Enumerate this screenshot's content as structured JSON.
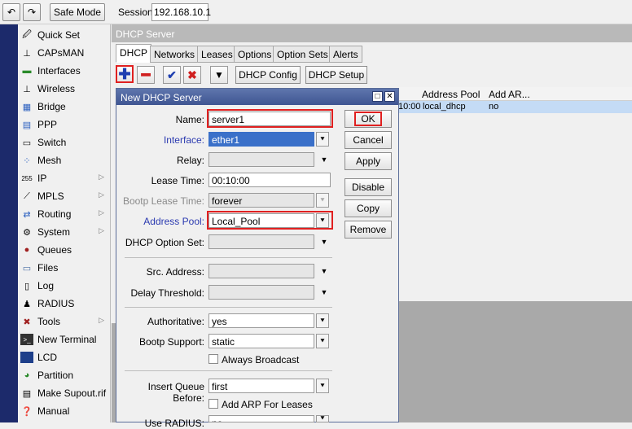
{
  "toolbar": {
    "undo_icon": "undo-icon",
    "redo_icon": "redo-icon",
    "safe_mode": "Safe Mode",
    "session_label": "Session:",
    "session_value": "192.168.10.1"
  },
  "sidebar": {
    "items": [
      {
        "label": "Quick Set",
        "icon": "quick-set-icon"
      },
      {
        "label": "CAPsMAN",
        "icon": "capsman-icon"
      },
      {
        "label": "Interfaces",
        "icon": "interfaces-icon"
      },
      {
        "label": "Wireless",
        "icon": "wireless-icon"
      },
      {
        "label": "Bridge",
        "icon": "bridge-icon"
      },
      {
        "label": "PPP",
        "icon": "ppp-icon"
      },
      {
        "label": "Switch",
        "icon": "switch-icon"
      },
      {
        "label": "Mesh",
        "icon": "mesh-icon"
      },
      {
        "label": "IP",
        "icon": "ip-icon",
        "submenu": true
      },
      {
        "label": "MPLS",
        "icon": "mpls-icon",
        "submenu": true
      },
      {
        "label": "Routing",
        "icon": "routing-icon",
        "submenu": true
      },
      {
        "label": "System",
        "icon": "system-icon",
        "submenu": true
      },
      {
        "label": "Queues",
        "icon": "queues-icon"
      },
      {
        "label": "Files",
        "icon": "files-icon"
      },
      {
        "label": "Log",
        "icon": "log-icon"
      },
      {
        "label": "RADIUS",
        "icon": "radius-icon"
      },
      {
        "label": "Tools",
        "icon": "tools-icon",
        "submenu": true
      },
      {
        "label": "New Terminal",
        "icon": "terminal-icon"
      },
      {
        "label": "LCD",
        "icon": "lcd-icon"
      },
      {
        "label": "Partition",
        "icon": "partition-icon"
      },
      {
        "label": "Make Supout.rif",
        "icon": "supout-icon"
      },
      {
        "label": "Manual",
        "icon": "manual-icon"
      }
    ]
  },
  "dhcp_window": {
    "title": "DHCP Server",
    "tabs": [
      "DHCP",
      "Networks",
      "Leases",
      "Options",
      "Option Sets",
      "Alerts"
    ],
    "buttons": {
      "dhcp_config": "DHCP Config",
      "dhcp_setup": "DHCP Setup"
    },
    "columns": [
      "Address Pool",
      "Add AR..."
    ],
    "row": {
      "lease_fragment": "10:00",
      "address_pool": "local_dhcp",
      "add_arp": "no"
    }
  },
  "dialog": {
    "title": "New DHCP Server",
    "fields": {
      "name": {
        "label": "Name:",
        "value": "server1"
      },
      "interface": {
        "label": "Interface:",
        "value": "ether1"
      },
      "relay": {
        "label": "Relay:",
        "value": ""
      },
      "lease_time": {
        "label": "Lease Time:",
        "value": "00:10:00"
      },
      "bootp_lease_time": {
        "label": "Bootp Lease Time:",
        "value": "forever"
      },
      "address_pool": {
        "label": "Address Pool:",
        "value": "Local_Pool"
      },
      "dhcp_option_set": {
        "label": "DHCP Option Set:",
        "value": ""
      },
      "src_address": {
        "label": "Src. Address:",
        "value": ""
      },
      "delay_threshold": {
        "label": "Delay Threshold:",
        "value": ""
      },
      "authoritative": {
        "label": "Authoritative:",
        "value": "yes"
      },
      "bootp_support": {
        "label": "Bootp Support:",
        "value": "static"
      },
      "always_broadcast": {
        "label": "Always Broadcast",
        "checked": false
      },
      "insert_queue_before": {
        "label": "Insert Queue Before:",
        "value": "first"
      },
      "add_arp_for_leases": {
        "label": "Add ARP For Leases",
        "checked": false
      },
      "use_radius": {
        "label": "Use RADIUS:",
        "value": "no"
      }
    },
    "buttons": {
      "ok": "OK",
      "cancel": "Cancel",
      "apply": "Apply",
      "disable": "Disable",
      "copy": "Copy",
      "remove": "Remove"
    }
  },
  "colors": {
    "highlight": "#e02020",
    "title_bar": "#3f5592",
    "selection": "#3a70c9",
    "sidebar_strip": "#1c2a6b"
  }
}
